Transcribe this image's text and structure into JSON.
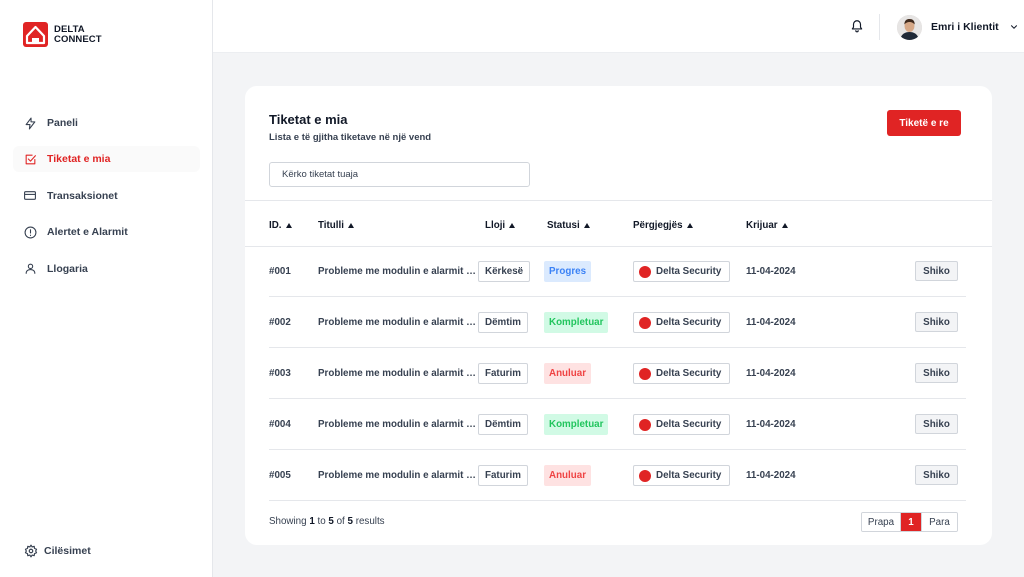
{
  "brand": {
    "line1": "DELTA",
    "line2": "CONNECT",
    "color": "#e02424"
  },
  "sidebar": {
    "items": [
      {
        "label": "Paneli",
        "icon": "bolt-icon"
      },
      {
        "label": "Tiketat e mia",
        "icon": "checkbox-icon",
        "active": true
      },
      {
        "label": "Transaksionet",
        "icon": "credit-card-icon"
      },
      {
        "label": "Alertet e Alarmit",
        "icon": "alert-circle-icon"
      },
      {
        "label": "Llogaria",
        "icon": "user-icon"
      }
    ],
    "settings_label": "Cilësimet"
  },
  "topbar": {
    "user_name": "Emri i Klientit"
  },
  "page": {
    "title": "Tiketat e mia",
    "subtitle": "Lista e të gjitha tiketave në një vend",
    "new_button": "Tiketë e re",
    "search_placeholder": "Kërko tiketat tuaja"
  },
  "table": {
    "headers": {
      "id": "ID.",
      "title": "Titulli",
      "type": "Lloji",
      "status": "Statusi",
      "responsible": "Përgjegjës",
      "created": "Krijuar"
    },
    "rows": [
      {
        "id": "#001",
        "title": "Probleme me modulin e alarmit të sigurisë",
        "type": "Kërkesë",
        "status": "Progres",
        "status_kind": "progres",
        "responsible": "Delta Security",
        "created": "11-04-2024",
        "action": "Shiko"
      },
      {
        "id": "#002",
        "title": "Probleme me modulin e alarmit të sigurisë",
        "type": "Dëmtim",
        "status": "Kompletuar",
        "status_kind": "komplet",
        "responsible": "Delta Security",
        "created": "11-04-2024",
        "action": "Shiko"
      },
      {
        "id": "#003",
        "title": "Probleme me modulin e alarmit të sigurisë",
        "type": "Faturim",
        "status": "Anuluar",
        "status_kind": "anuluar",
        "responsible": "Delta Security",
        "created": "11-04-2024",
        "action": "Shiko"
      },
      {
        "id": "#004",
        "title": "Probleme me modulin e alarmit të sigurisë",
        "type": "Dëmtim",
        "status": "Kompletuar",
        "status_kind": "komplet",
        "responsible": "Delta Security",
        "created": "11-04-2024",
        "action": "Shiko"
      },
      {
        "id": "#005",
        "title": "Probleme me modulin e alarmit të sigurisë",
        "type": "Faturim",
        "status": "Anuluar",
        "status_kind": "anuluar",
        "responsible": "Delta Security",
        "created": "11-04-2024",
        "action": "Shiko"
      }
    ]
  },
  "footer": {
    "showing_prefix": "Showing",
    "from": "1",
    "to_word": "to",
    "to": "5",
    "of_word": "of",
    "total": "5",
    "results_word": "results",
    "prev": "Prapa",
    "current_page": "1",
    "next": "Para"
  }
}
